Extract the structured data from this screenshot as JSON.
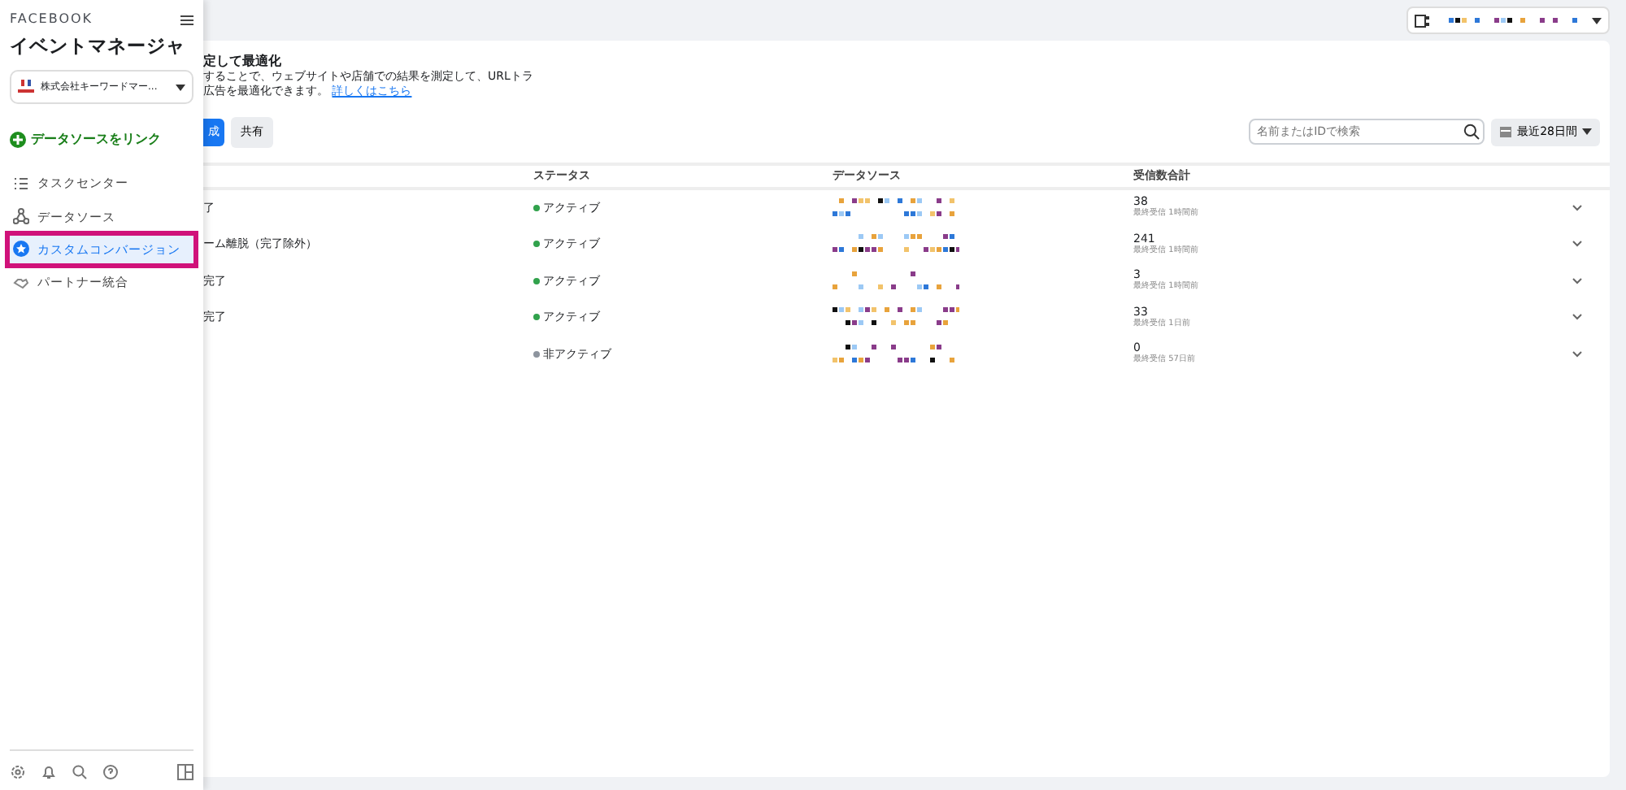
{
  "sidebar": {
    "brand": "FACEBOOK",
    "title": "イベントマネージャ",
    "account": "株式会社キーワードマー...",
    "link_source": "データソースをリンク",
    "items": [
      {
        "label": "タスクセンター",
        "selected": false
      },
      {
        "label": "データソース",
        "selected": false
      },
      {
        "label": "カスタムコンバージョン",
        "selected": true
      },
      {
        "label": "パートナー統合",
        "selected": false
      }
    ]
  },
  "intro": {
    "heading": "定して最適化",
    "line_1": "することで、ウェブサイトや店舗での結果を測定して、URLトラ",
    "line_2": "広告を最適化できます。",
    "link": "詳しくはこちら"
  },
  "buttons": [
    {
      "label": "成",
      "kind": "primary"
    },
    {
      "label": "共有",
      "kind": "secondary"
    }
  ],
  "search": {
    "placeholder": "名前またはIDで検索"
  },
  "date_range": "最近28日間",
  "table": {
    "columns": [
      "ステータス",
      "データソース",
      "受信数合計"
    ],
    "rows": [
      {
        "name": "了",
        "status": "アクティブ",
        "active": true,
        "count": "38",
        "last": "最終受信 1時間前"
      },
      {
        "name": "ーム離脱（完了除外）",
        "status": "アクティブ",
        "active": true,
        "count": "241",
        "last": "最終受信 1時間前"
      },
      {
        "name": "完了",
        "status": "アクティブ",
        "active": true,
        "count": "3",
        "last": "最終受信 1時間前"
      },
      {
        "name": "完了",
        "status": "アクティブ",
        "active": true,
        "count": "33",
        "last": "最終受信 1日前"
      },
      {
        "status": "非アクティブ",
        "active": false,
        "count": "0",
        "last": "最終受信 57日前"
      }
    ]
  }
}
